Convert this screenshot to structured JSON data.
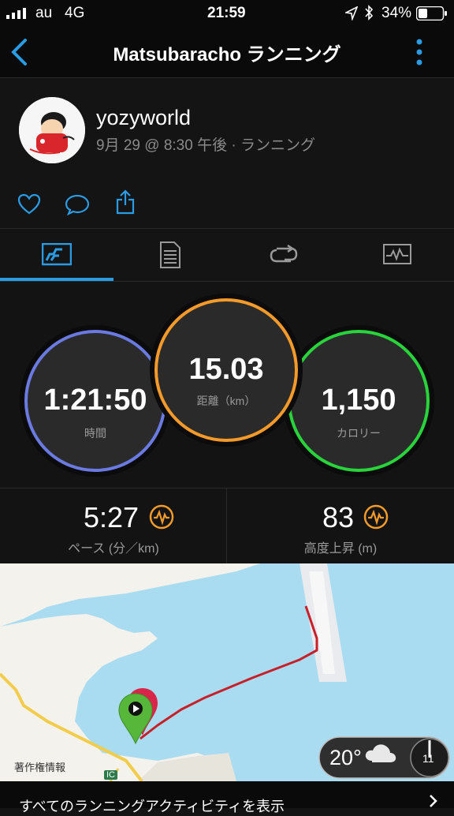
{
  "status_bar": {
    "carrier": "au",
    "network": "4G",
    "time": "21:59",
    "battery": "34%"
  },
  "nav": {
    "title": "Matsubaracho ランニング"
  },
  "profile": {
    "username": "yozyworld",
    "meta": "9月 29 @ 8:30 午後 · ランニング"
  },
  "stats": {
    "time_value": "1:21:50",
    "time_label": "時間",
    "distance_value": "15.03",
    "distance_label": "距離（km）",
    "calories_value": "1,150",
    "calories_label": "カロリー"
  },
  "metrics": {
    "pace_value": "5:27",
    "pace_label": "ペース (分／km)",
    "elevation_value": "83",
    "elevation_label": "高度上昇 (m)"
  },
  "map": {
    "area_label": "著作権情報",
    "road_marker": "IC",
    "weather_temp": "20°",
    "wind_value": "11"
  },
  "footer": {
    "link_text": "すべてのランニングアクティビティを表示"
  },
  "colors": {
    "accent_blue": "#2b9be3",
    "ring_time": "#6a7ae0",
    "ring_distance": "#f39a2b",
    "ring_calories": "#29d33b",
    "route": "#c8202a"
  }
}
